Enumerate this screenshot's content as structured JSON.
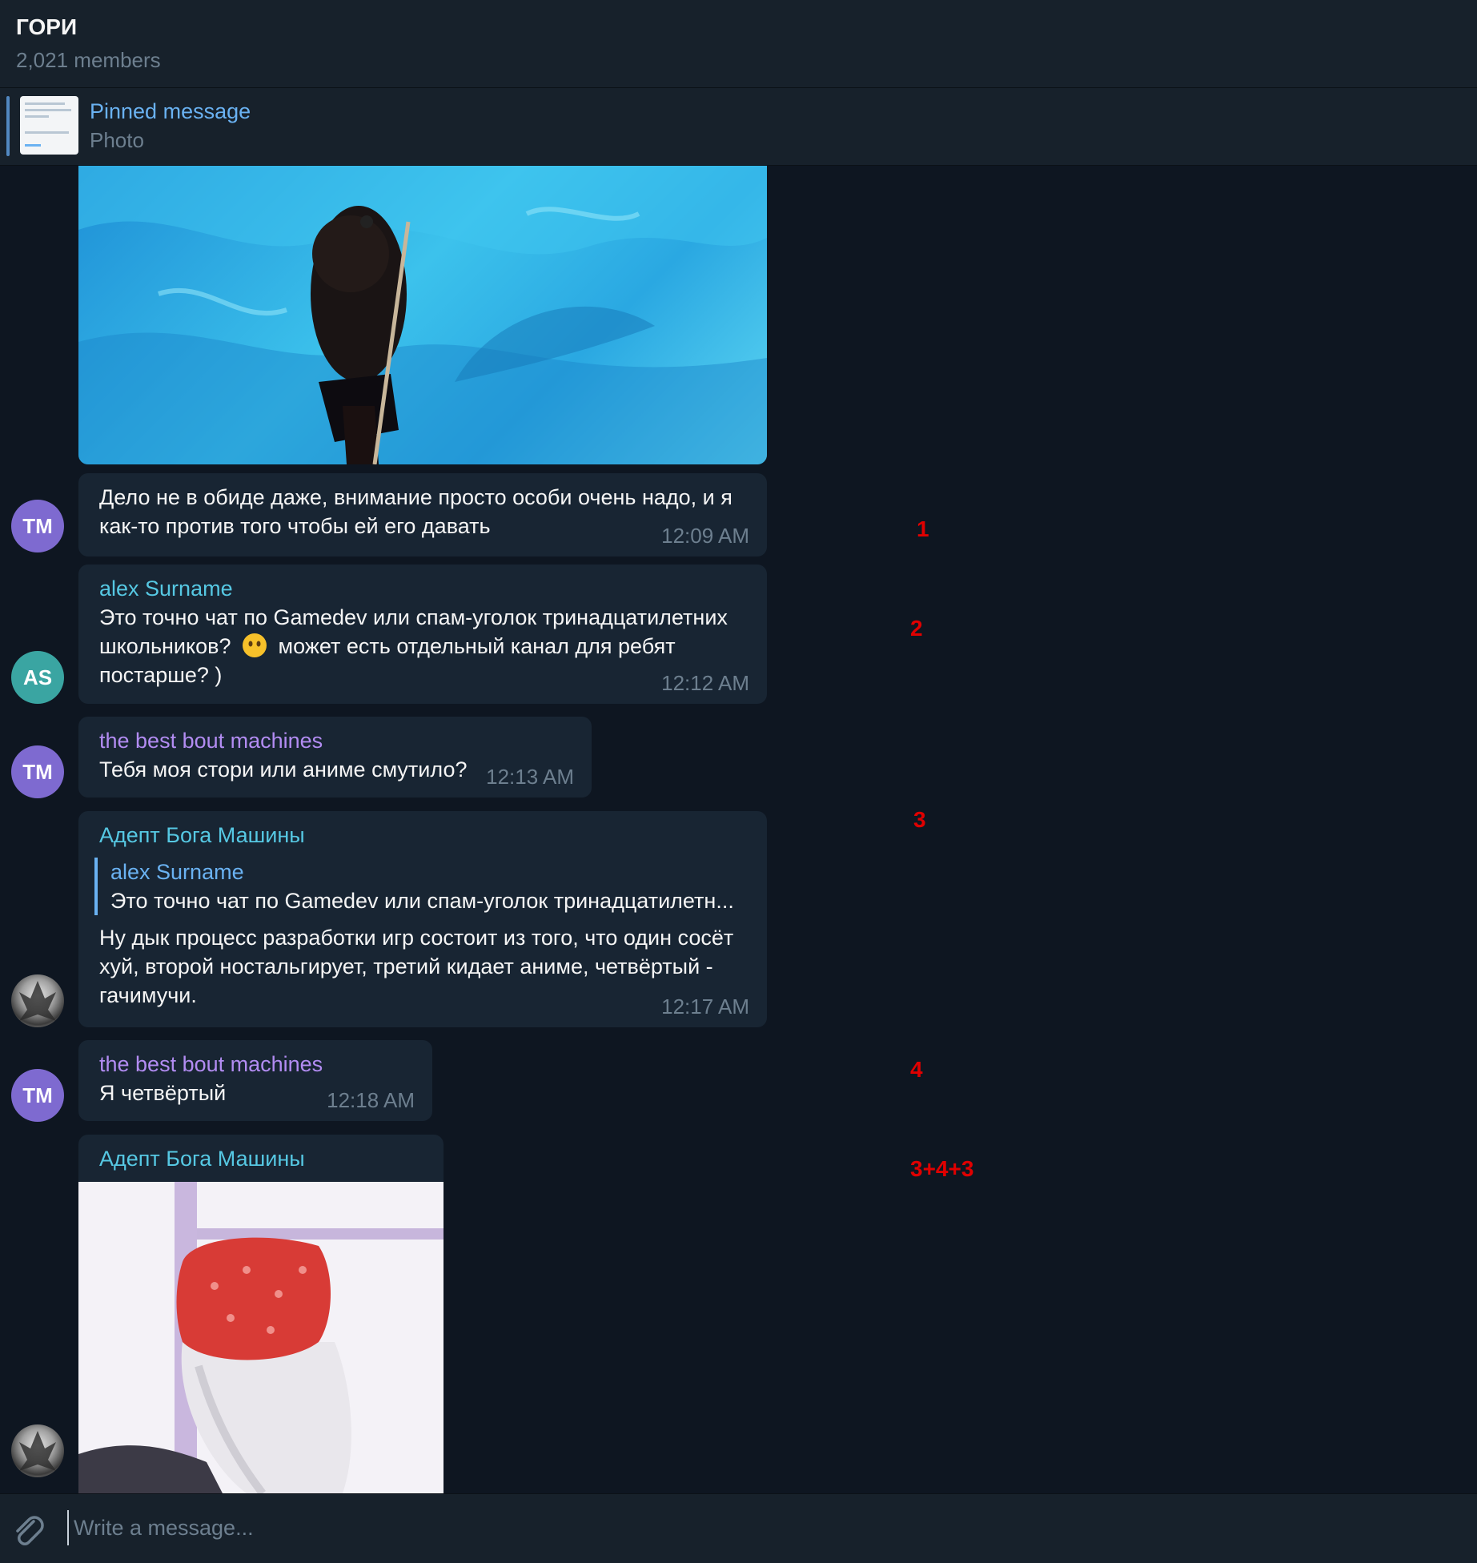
{
  "header": {
    "title": "ГОРИ",
    "members": "2,021 members"
  },
  "pinned": {
    "label": "Pinned message",
    "subtitle": "Photo"
  },
  "messages": [
    {
      "avatar": "TM",
      "text": "Дело не в обиде даже, внимание просто особи очень надо, и я как-то против того чтобы ей его давать",
      "time": "12:09 AM"
    },
    {
      "avatar": "AS",
      "sender": "alex Surname",
      "text_a": "Это точно чат по Gamedev или спам-уголок тринадцатилетних школьников?",
      "emoji": "face-without-mouth",
      "text_b": "может есть отдельный канал для ребят постарше? )",
      "time": "12:12 AM"
    },
    {
      "avatar": "TM",
      "sender": "the best bout machines",
      "text": "Тебя моя стори или аниме смутило?",
      "time": "12:13 AM"
    },
    {
      "avatar": "image",
      "sender": "Адепт Бога Машины",
      "reply_sender": "alex Surname",
      "reply_text": "Это точно чат по Gamedev или спам-уголок тринадцатилетн...",
      "text": "Ну дык процесс разработки игр состоит из того, что один сосёт хуй, второй ностальгирует, третий кидает аниме, четвёртый - гачимучи.",
      "time": "12:17 AM"
    },
    {
      "avatar": "TM",
      "sender": "the best bout machines",
      "text": "Я четвёртый",
      "time": "12:18 AM"
    },
    {
      "avatar": "image",
      "sender": "Адепт Бога Машины"
    }
  ],
  "annotations": [
    "1",
    "2",
    "3",
    "4",
    "3+4+3"
  ],
  "composer": {
    "placeholder": "Write a message...",
    "attach_icon": "paperclip-icon"
  },
  "colors": {
    "background": "#0e1621",
    "bubble": "#182533",
    "accent": "#6ab2f2",
    "sender_teal": "#56c8e3",
    "sender_purple": "#b28cf2",
    "annotation": "#e00000"
  }
}
